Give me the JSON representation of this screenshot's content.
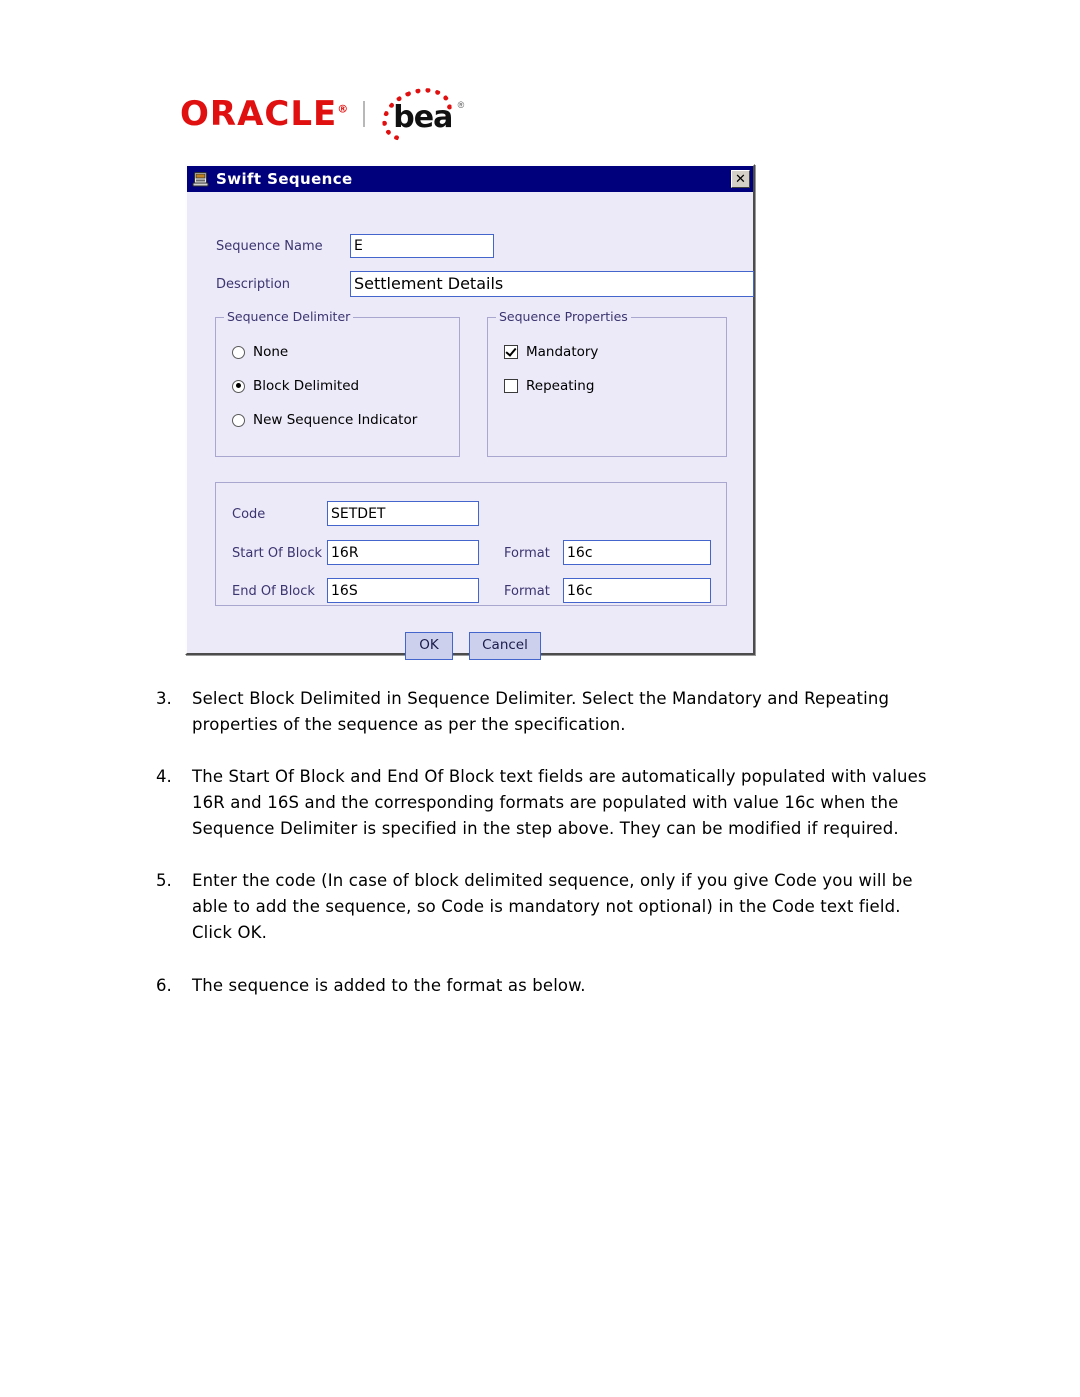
{
  "brand": {
    "oracle": "ORACLE",
    "oracle_tm": "®",
    "bea": "bea",
    "bea_tm": "®"
  },
  "dialog": {
    "title": "Swift Sequence",
    "icon": "app-window-icon",
    "close_label": "✕",
    "fields": {
      "sequence_name_label": "Sequence Name",
      "sequence_name_value": "E",
      "description_label": "Description",
      "description_value": "Settlement Details"
    },
    "sequence_delimiter": {
      "legend": "Sequence Delimiter",
      "options": [
        {
          "label": "None",
          "selected": false
        },
        {
          "label": "Block Delimited",
          "selected": true
        },
        {
          "label": "New Sequence Indicator",
          "selected": false
        }
      ]
    },
    "sequence_properties": {
      "legend": "Sequence Properties",
      "options": [
        {
          "label": "Mandatory",
          "checked": true
        },
        {
          "label": "Repeating",
          "checked": false
        }
      ]
    },
    "block_panel": {
      "code_label": "Code",
      "code_value": "SETDET",
      "start_label": "Start Of Block",
      "start_value": "16R",
      "start_format_label": "Format",
      "start_format_value": "16c",
      "end_label": "End Of Block",
      "end_value": "16S",
      "end_format_label": "Format",
      "end_format_value": "16c"
    },
    "buttons": {
      "ok": "OK",
      "cancel": "Cancel"
    }
  },
  "steps": [
    {
      "number": "3.",
      "text": "Select Block Delimited in Sequence Delimiter. Select the Mandatory and Repeating properties of the sequence as per the specification."
    },
    {
      "number": "4.",
      "text": "The Start Of Block and End Of Block text fields are automatically populated with values 16R and 16S and the corresponding formats are populated with value 16c when the Sequence Delimiter is specified in the step above. They can be modified if required."
    },
    {
      "number": "5.",
      "text": "Enter the code  (In case of block delimited sequence, only if you give Code you will be able to add the sequence, so Code is mandatory not optional) in the Code text field. Click OK."
    },
    {
      "number": "6.",
      "text": "The sequence is added to the format as below."
    }
  ],
  "colors": {
    "oracle_red": "#e01010",
    "titlebar_blue": "#00007c",
    "dialog_bg": "#ece9f8",
    "field_border": "#4466cc",
    "label_text": "#3b3570"
  }
}
